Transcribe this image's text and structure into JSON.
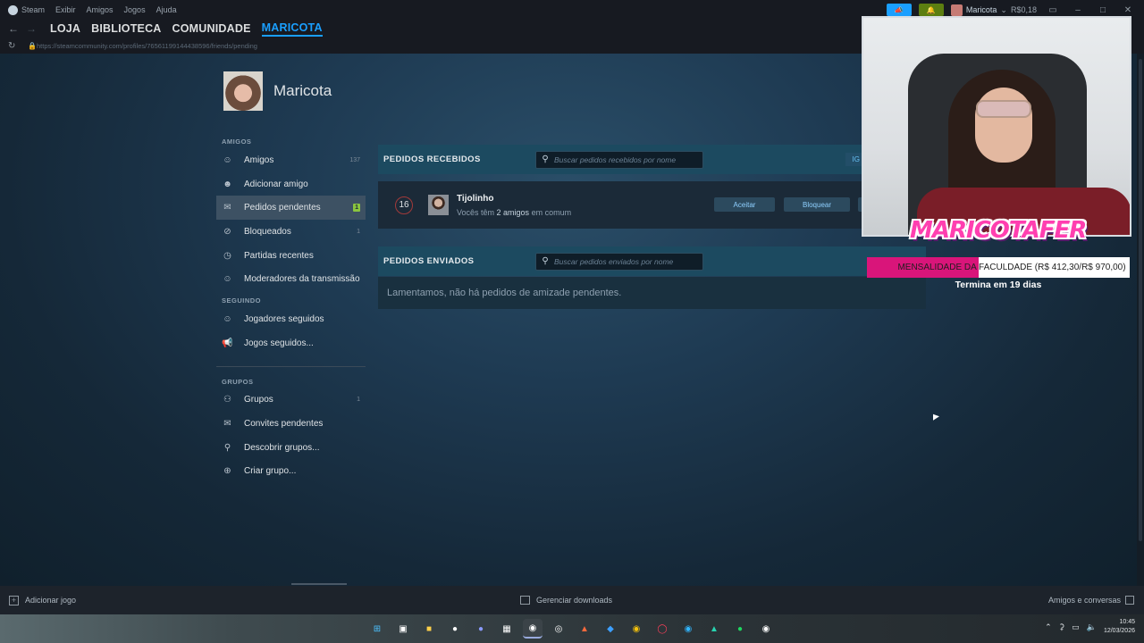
{
  "menubar": {
    "app_name": "Steam",
    "items": [
      "Exibir",
      "Amigos",
      "Jogos",
      "Ajuda"
    ],
    "user": {
      "name": "Maricota",
      "balance": "R$0,18"
    }
  },
  "nav": {
    "tabs": [
      {
        "label": "LOJA"
      },
      {
        "label": "BIBLIOTECA"
      },
      {
        "label": "COMUNIDADE"
      },
      {
        "label": "MARICOTA"
      }
    ],
    "url": "https://steamcommunity.com/profiles/76561199144438596/friends/pending"
  },
  "profile": {
    "name": "Maricota"
  },
  "sidebar": {
    "sections": {
      "friends": "AMIGOS",
      "following": "SEGUINDO",
      "groups": "GRUPOS"
    },
    "friends_items": [
      {
        "label": "Amigos",
        "count": "137",
        "icon": "person-icon"
      },
      {
        "label": "Adicionar amigo",
        "count": "",
        "icon": "add-person-icon"
      },
      {
        "label": "Pedidos pendentes",
        "count": "1",
        "icon": "envelope-icon"
      },
      {
        "label": "Bloqueados",
        "count": "1",
        "icon": "block-icon"
      },
      {
        "label": "Partidas recentes",
        "count": "",
        "icon": "clock-icon"
      },
      {
        "label": "Moderadores da transmissão",
        "count": "",
        "icon": "moderator-icon"
      }
    ],
    "following_items": [
      {
        "label": "Jogadores seguidos",
        "icon": "people-icon"
      },
      {
        "label": "Jogos seguidos...",
        "icon": "megaphone-icon"
      }
    ],
    "groups_items": [
      {
        "label": "Grupos",
        "count": "1",
        "icon": "group-icon"
      },
      {
        "label": "Convites pendentes",
        "count": "",
        "icon": "envelope-icon"
      },
      {
        "label": "Descobrir grupos...",
        "count": "",
        "icon": "search-icon"
      },
      {
        "label": "Criar grupo...",
        "count": "",
        "icon": "plus-circle-icon"
      }
    ]
  },
  "received": {
    "title": "PEDIDOS RECEBIDOS",
    "search_placeholder": "Buscar pedidos recebidos por nome",
    "head_link": "IG",
    "request": {
      "level": "16",
      "name": "Tijolinho",
      "mutual_prefix": "Vocês têm ",
      "mutual_count": "2 amigos",
      "mutual_suffix": " em comum",
      "accept": "Aceitar",
      "block": "Bloquear"
    }
  },
  "sent": {
    "title": "PEDIDOS ENVIADOS",
    "search_placeholder": "Buscar pedidos enviados por nome",
    "empty_message": "Lamentamos, não há pedidos de amizade pendentes."
  },
  "statusbar": {
    "add_game": "Adicionar jogo",
    "downloads": "Gerenciar downloads",
    "friends_chat": "Amigos e conversas"
  },
  "overlay": {
    "logo": "MARICOTAFER",
    "goal_text": "MENSALIDADE DA FACULDADE (R$ 412,30/R$ 970,00)",
    "goal_progress": 0.425,
    "goal_sub": "Termina em 19 dias",
    "goal_fill_color": "#d9157a"
  },
  "taskbar": {
    "time": "10:45",
    "date": "12/03/2026"
  }
}
